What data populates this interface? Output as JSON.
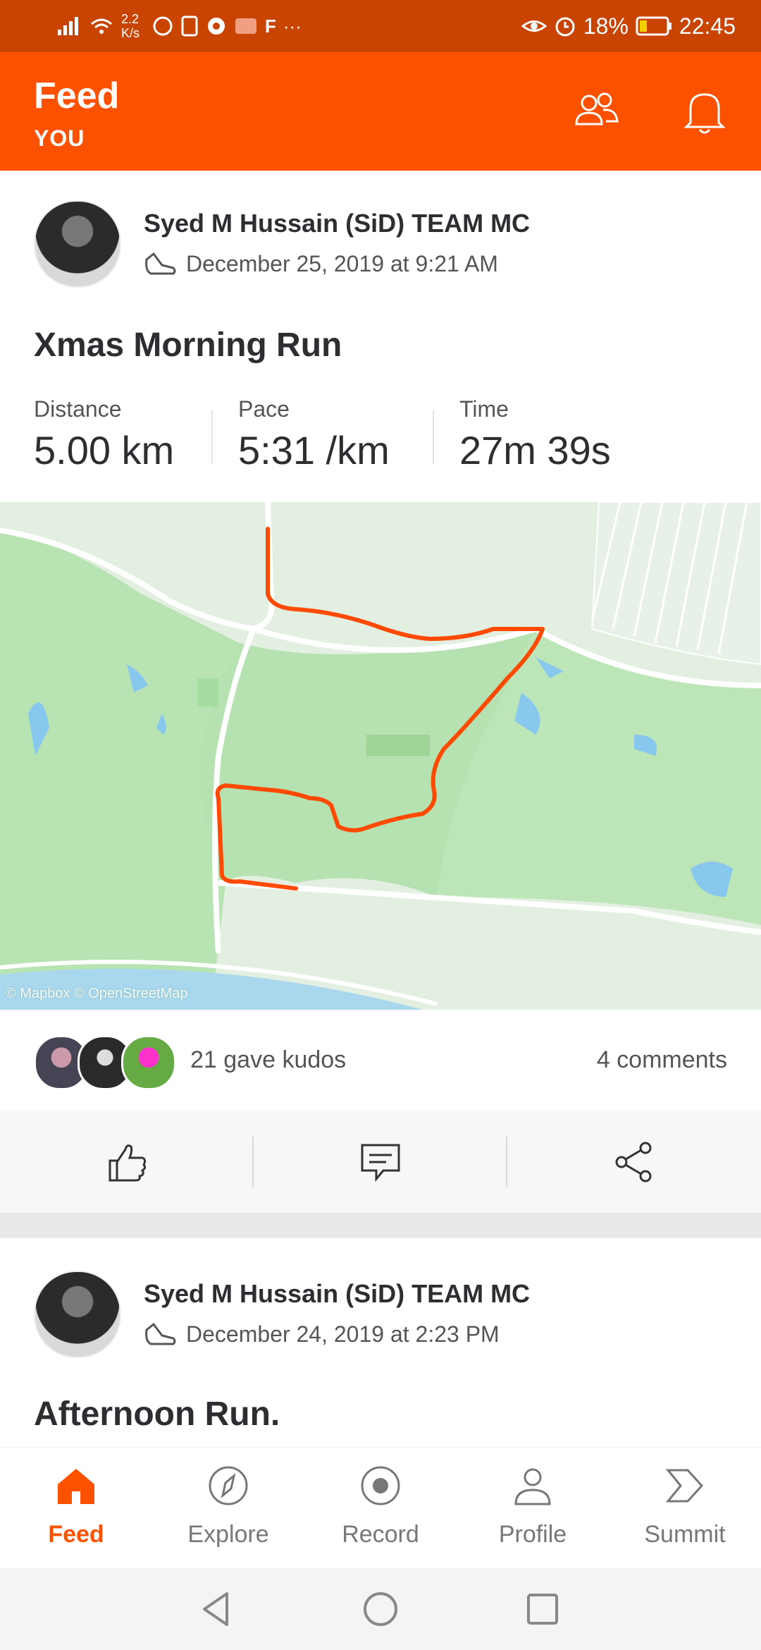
{
  "status_bar": {
    "net_speed": "2.2\nK/s",
    "battery": "18%",
    "time": "22:45",
    "more": "···",
    "f_label": "F"
  },
  "header": {
    "title": "Feed",
    "subtitle": "YOU"
  },
  "posts": [
    {
      "author": "Syed M Hussain (SiD) TEAM MC",
      "date": "December 25, 2019 at 9:21 AM",
      "title": "Xmas Morning Run",
      "stats": [
        {
          "label": "Distance",
          "value": "5.00 km"
        },
        {
          "label": "Pace",
          "value": "5:31 /km"
        },
        {
          "label": "Time",
          "value": "27m 39s"
        }
      ],
      "map_attribution": "© Mapbox © OpenStreetMap",
      "kudos": "21 gave kudos",
      "comments": "4 comments"
    },
    {
      "author": "Syed M Hussain (SiD) TEAM MC",
      "date": "December 24, 2019 at 2:23 PM",
      "title": "Afternoon Run."
    }
  ],
  "bottom_nav": [
    {
      "label": "Feed",
      "icon": "home-icon",
      "active": true
    },
    {
      "label": "Explore",
      "icon": "compass-icon",
      "active": false
    },
    {
      "label": "Record",
      "icon": "record-icon",
      "active": false
    },
    {
      "label": "Profile",
      "icon": "profile-icon",
      "active": false
    },
    {
      "label": "Summit",
      "icon": "summit-icon",
      "active": false
    }
  ],
  "colors": {
    "brand": "#fc5200",
    "status_bar": "#c94400",
    "route": "#ff4a00"
  }
}
